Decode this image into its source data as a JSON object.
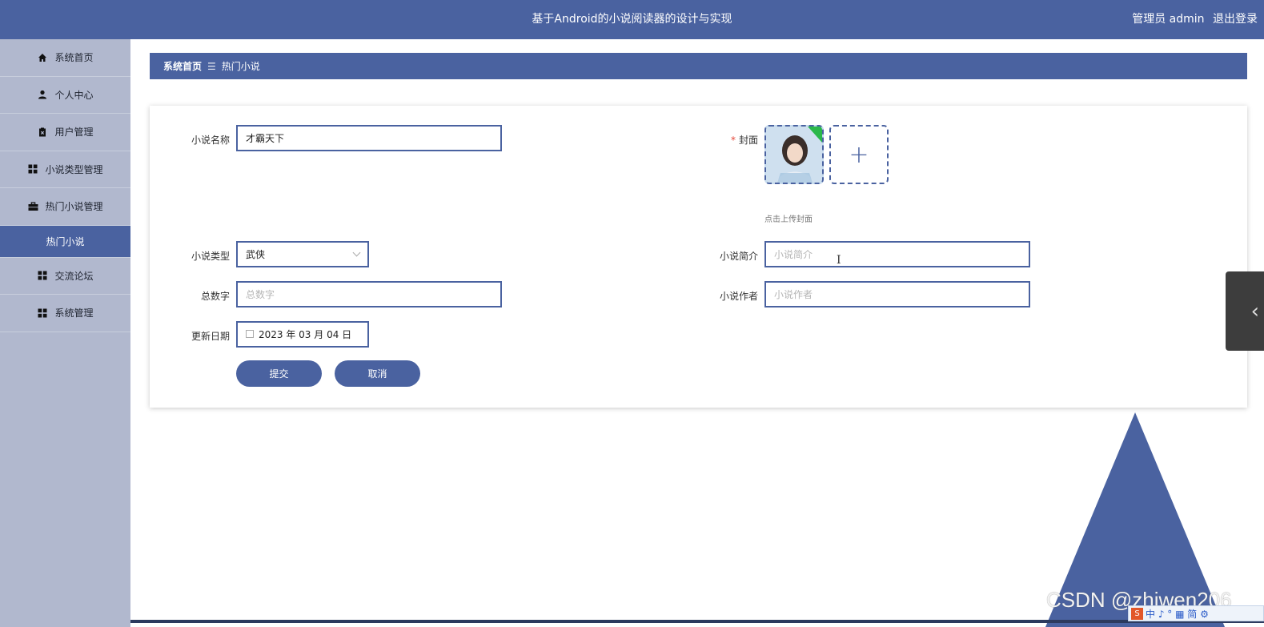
{
  "header": {
    "title": "基于Android的小说阅读器的设计与实现",
    "role": "管理员 admin",
    "logout": "退出登录"
  },
  "sidebar": {
    "items": [
      {
        "label": "系统首页",
        "icon": "home-icon"
      },
      {
        "label": "个人中心",
        "icon": "user-icon"
      },
      {
        "label": "用户管理",
        "icon": "clipboard-icon"
      },
      {
        "label": "小说类型管理",
        "icon": "grid-icon"
      },
      {
        "label": "热门小说管理",
        "icon": "briefcase-icon"
      },
      {
        "label": "热门小说",
        "icon": ""
      },
      {
        "label": "交流论坛",
        "icon": "grid-icon"
      },
      {
        "label": "系统管理",
        "icon": "grid-icon"
      }
    ],
    "active_index": 5
  },
  "breadcrumb": {
    "home": "系统首页",
    "separator": "☰",
    "current": "热门小说"
  },
  "form": {
    "name_label": "小说名称",
    "name_value": "才霸天下",
    "cover_required": "*",
    "cover_label": "封面",
    "cover_hint": "点击上传封面",
    "type_label": "小说类型",
    "type_value": "武侠",
    "intro_label": "小说简介",
    "intro_placeholder": "小说简介",
    "words_label": "总数字",
    "words_placeholder": "总数字",
    "author_label": "小说作者",
    "author_placeholder": "小说作者",
    "date_label": "更新日期",
    "date_value": "2023 年 03 月 04 日",
    "submit": "提交",
    "cancel": "取消"
  },
  "overlay": {
    "watermark": "CSDN @zhiwen206",
    "ime": "中 ♪ ° ▦ 简 ⚙",
    "ime_logo": "S"
  },
  "colors": {
    "primary": "#4a62a0",
    "sidebar_bg": "#b1b8ce"
  }
}
